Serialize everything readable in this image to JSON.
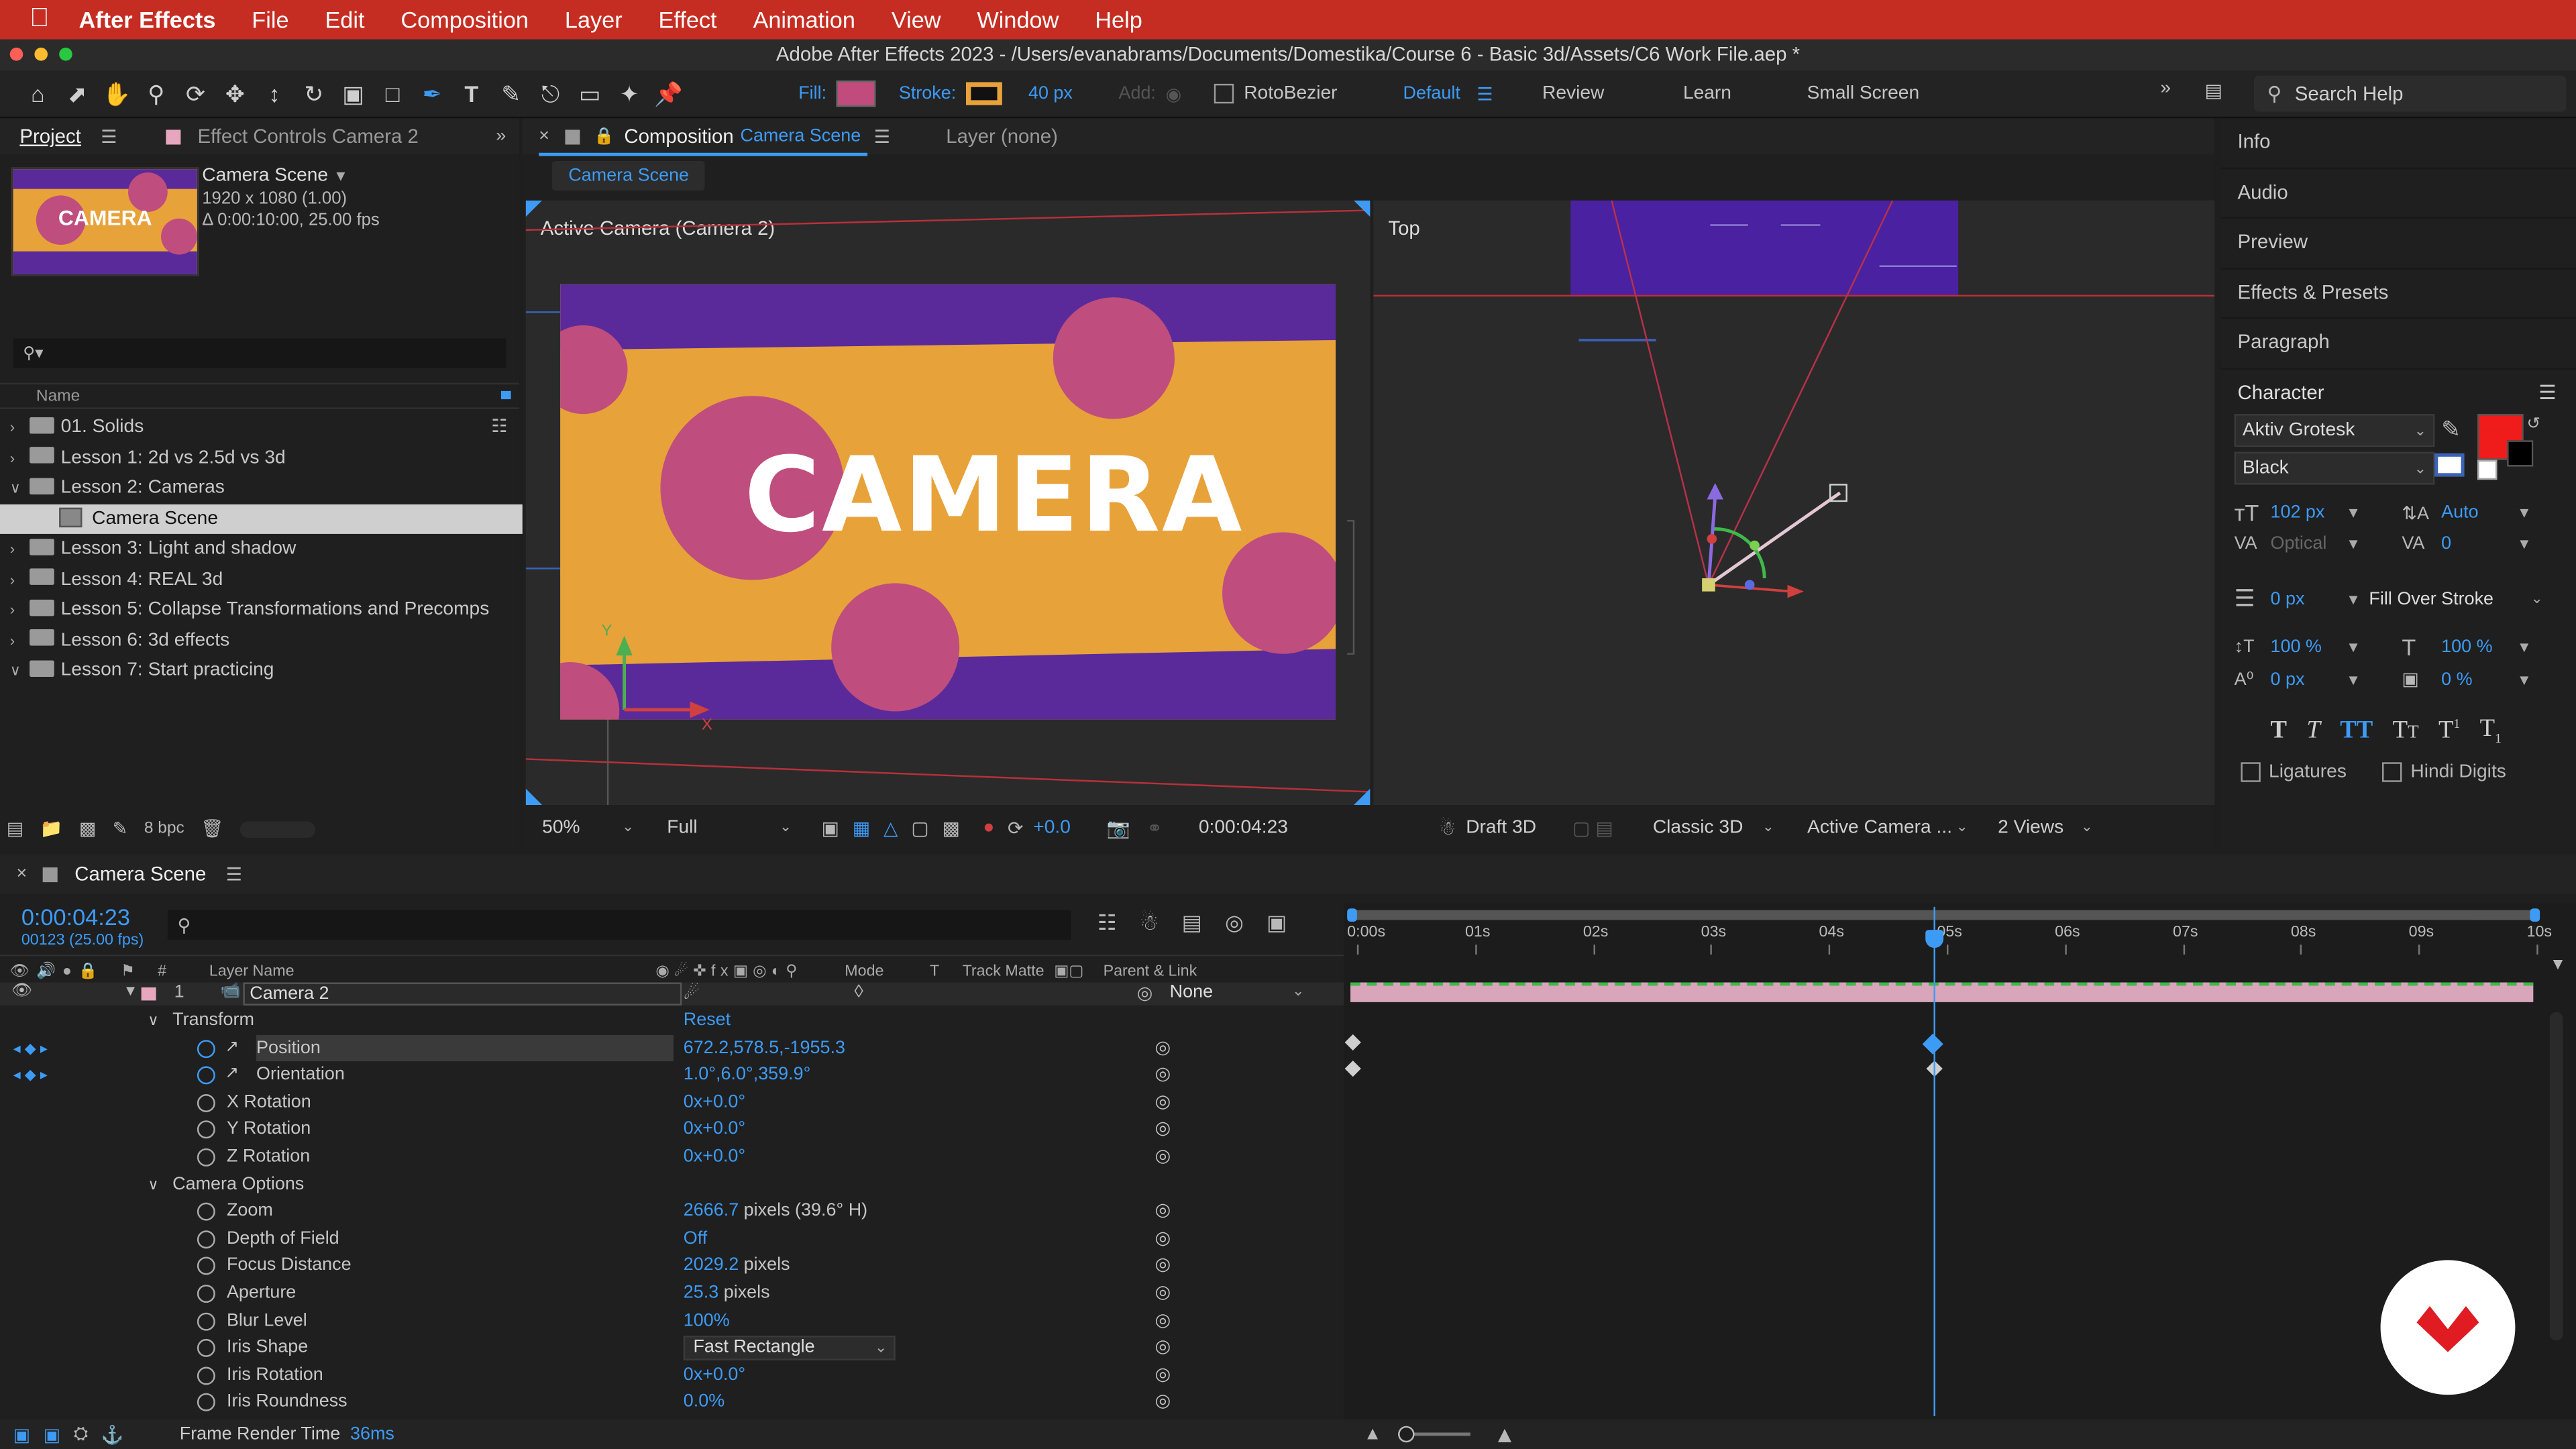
{
  "menubar": {
    "app": "After Effects",
    "items": [
      "File",
      "Edit",
      "Composition",
      "Layer",
      "Effect",
      "Animation",
      "View",
      "Window",
      "Help"
    ]
  },
  "titlebar": "Adobe After Effects 2023 - /Users/evanabrams/Documents/Domestika/Course 6 - Basic 3d/Assets/C6 Work File.aep *",
  "toolbar": {
    "fill_label": "Fill:",
    "stroke_label": "Stroke:",
    "stroke_px": "40 px",
    "add_label": "Add:",
    "rotobezier": "RotoBezier",
    "workspaces": [
      "Default",
      "Review",
      "Learn",
      "Small Screen"
    ],
    "search_placeholder": "Search Help",
    "colors": {
      "fill": "#c04b7c",
      "stroke": "#e8a23a"
    }
  },
  "project": {
    "tab_project": "Project",
    "tab_effect": "Effect Controls Camera 2",
    "thumb_text": "CAMERA",
    "comp_name": "Camera Scene",
    "comp_res": "1920 x 1080 (1.00)",
    "comp_dur": "Δ 0:00:10:00, 25.00 fps",
    "col_name": "Name",
    "items": [
      {
        "label": "01. Solids",
        "open": false,
        "indent": 0
      },
      {
        "label": "Lesson 1: 2d vs 2.5d vs 3d",
        "open": false,
        "indent": 0
      },
      {
        "label": "Lesson 2: Cameras",
        "open": true,
        "indent": 0
      },
      {
        "label": "Camera Scene",
        "open": false,
        "indent": 1,
        "selected": true
      },
      {
        "label": "Lesson 3: Light and shadow",
        "open": false,
        "indent": 0
      },
      {
        "label": "Lesson 4: REAL 3d",
        "open": false,
        "indent": 0
      },
      {
        "label": "Lesson 5: Collapse Transformations and Precomps",
        "open": false,
        "indent": 0
      },
      {
        "label": "Lesson 6: 3d effects",
        "open": false,
        "indent": 0
      },
      {
        "label": "Lesson 7:  Start practicing",
        "open": true,
        "indent": 0
      }
    ],
    "bpc": "8 bpc"
  },
  "comp": {
    "tab_label": "Composition",
    "tab_comp_name": "Camera Scene",
    "layer_tab": "Layer (none)",
    "breadcrumb": "Camera Scene",
    "active_camera_label": "Active Camera (Camera 2)",
    "top_label": "Top",
    "camera_text": "CAMERA",
    "zoom": "50%",
    "quality": "Full",
    "exposure": "+0.0",
    "timecode": "0:00:04:23",
    "draft3d": "Draft 3D",
    "renderer": "Classic 3D",
    "view": "Active Camera ...",
    "views": "2 Views"
  },
  "right": {
    "items": [
      "Info",
      "Audio",
      "Preview",
      "Effects & Presets",
      "Paragraph"
    ],
    "character_title": "Character",
    "font": "Aktiv Grotesk",
    "style": "Black",
    "size": "102 px",
    "leading": "Auto",
    "kerning": "Optical",
    "tracking": "0",
    "stroke_w": "0 px",
    "stroke_mode": "Fill Over Stroke",
    "vscale": "100 %",
    "hscale": "100 %",
    "baseline": "0 px",
    "tsume": "0 %",
    "ligatures": "Ligatures",
    "hindi": "Hindi Digits",
    "fill_color": "#f01b1b"
  },
  "timeline": {
    "tab": "Camera Scene",
    "timecode": "0:00:04:23",
    "frame_info": "00123 (25.00 fps)",
    "col_layer": "Layer Name",
    "col_mode": "Mode",
    "col_t": "T",
    "col_track": "Track Matte",
    "col_parent": "Parent & Link",
    "layer_num": "1",
    "layer_name": "Camera 2",
    "parent": "None",
    "ticks": [
      "0:00s",
      "01s",
      "02s",
      "03s",
      "04s",
      "05s",
      "06s",
      "07s",
      "08s",
      "09s",
      "10s"
    ],
    "props": [
      {
        "label": "Transform",
        "value": "Reset",
        "level": 1,
        "group": true
      },
      {
        "label": "Position",
        "value": "672.2,578.5,-1955.3",
        "level": 2,
        "kf": true
      },
      {
        "label": "Orientation",
        "value": "1.0°,6.0°,359.9°",
        "level": 2,
        "kf": true
      },
      {
        "label": "X Rotation",
        "value": "0x+0.0°",
        "level": 2
      },
      {
        "label": "Y Rotation",
        "value": "0x+0.0°",
        "level": 2
      },
      {
        "label": "Z Rotation",
        "value": "0x+0.0°",
        "level": 2
      },
      {
        "label": "Camera Options",
        "value": "",
        "level": 1,
        "group": true
      },
      {
        "label": "Zoom",
        "value": "2666.7",
        "suffix": " pixels (39.6° H)",
        "level": 2
      },
      {
        "label": "Depth of Field",
        "value": "Off",
        "level": 2
      },
      {
        "label": "Focus Distance",
        "value": "2029.2",
        "suffix": " pixels",
        "level": 2
      },
      {
        "label": "Aperture",
        "value": "25.3",
        "suffix": " pixels",
        "level": 2
      },
      {
        "label": "Blur Level",
        "value": "100%",
        "level": 2
      },
      {
        "label": "Iris Shape",
        "value": "Fast Rectangle",
        "level": 2,
        "dropdown": true
      },
      {
        "label": "Iris Rotation",
        "value": "0x+0.0°",
        "level": 2
      },
      {
        "label": "Iris Roundness",
        "value": "0.0%",
        "level": 2
      }
    ],
    "frame_render_label": "Frame Render Time",
    "frame_render_value": "36ms"
  }
}
